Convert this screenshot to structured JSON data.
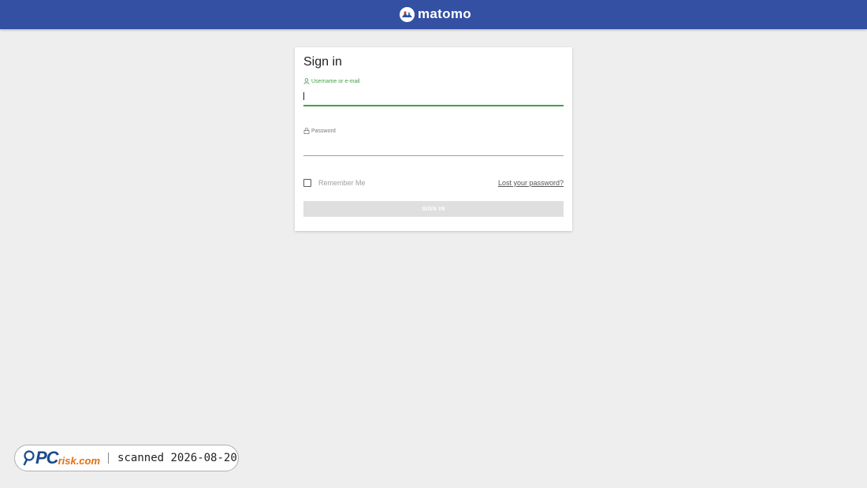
{
  "header": {
    "brand": "matomo",
    "logo_icon": "matomo-logo-icon",
    "background": "#3450a3"
  },
  "login": {
    "title": "Sign in",
    "username_label": "Username or e-mail",
    "username_value": "",
    "password_label": "Password",
    "password_value": "",
    "remember_label": "Remember Me",
    "remember_checked": false,
    "lost_password": "Lost your password?",
    "submit_label": "SIGN IN",
    "accent_color": "#43a047"
  },
  "watermark": {
    "brand_main": "PC",
    "brand_sub": "risk.com",
    "scanned_text": "scanned 2026-08-20"
  }
}
